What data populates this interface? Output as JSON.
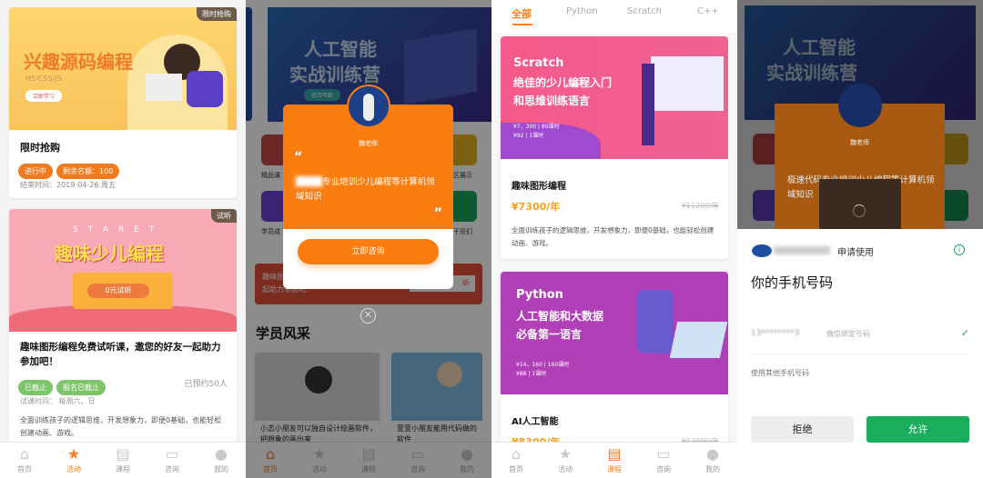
{
  "colors": {
    "accent": "#f57d22",
    "green": "#7ec46a",
    "wechat_green": "#1aad5b"
  },
  "nav": [
    "首页",
    "活动",
    "课程",
    "咨询",
    "我的"
  ],
  "panel1": {
    "card1": {
      "tag": "限时抢购",
      "banner_title": "兴趣源码编程",
      "banner_sub": "H5/CSS/JS",
      "banner_button": "立即学习",
      "title": "限时抢购",
      "badges": [
        "进行中",
        "剩余名额：100"
      ],
      "end_time": "结束时间：2019-04-26 周五"
    },
    "card2": {
      "tag": "试听",
      "banner_letters": "S T A R E T",
      "banner_title": "趣味少儿编程",
      "banner_button": "0元试听",
      "title": "趣味图形编程免费试听课，邀您的好友一起助力参加吧！",
      "badges": [
        "已截止",
        "报名已截止"
      ],
      "booked": "已预约50人",
      "trial_time": "试课时间： 每周六、日",
      "desc": "全面训练孩子的逻辑思维，开发想象力，即便0基础，也能轻松创建动画、游戏。"
    }
  },
  "panel2": {
    "banner_title1": "人工智能",
    "banner_title2": "实战训练营",
    "banner_chip": "适合年龄",
    "grid_labels": [
      "精品课",
      "区展示",
      "学员成",
      "干货们"
    ],
    "popup": {
      "teacher": "魏老师",
      "quote": "专业培训少儿编程等计算机领域知识",
      "button": "立即咨询"
    },
    "promo": "趣味图形编程免费试听课，邀您的好友一起助力参加吧！",
    "promo_btn": "听",
    "section_title": "学员风采",
    "stories": [
      "小志小朋友可以独自设计绘画软件，把想象的画出来",
      "萱萱小朋友能用代码做的软件"
    ]
  },
  "panel3": {
    "tabs": [
      "全部",
      "Python",
      "Scratch",
      "C++"
    ],
    "courses": [
      {
        "banner_lang": "Scratch",
        "banner_l1": "绝佳的少儿编程入门",
        "banner_l2": "和思维训练语言",
        "banner_price1": "¥7，300 | 80课时",
        "banner_price2": "¥92 | 1课时",
        "title": "趣味图形编程",
        "price": "¥7300/年",
        "old_price": "¥11200/年",
        "desc": "全面训练孩子的逻辑思维，开发想象力，即便0基础，也能轻松创建动画、游戏。"
      },
      {
        "banner_lang": "Python",
        "banner_l1": "人工智能和大数据",
        "banner_l2": "必备第一语言",
        "banner_price1": "¥14，160 | 160课时",
        "banner_price2": "¥88 | 1课时",
        "title": "AI人工智能",
        "price": "¥8300/年",
        "old_price": "¥12000/年"
      }
    ]
  },
  "panel4": {
    "teacher": "魏老师",
    "quote": "极速代码专业培训少儿编程等计算机领域知识",
    "sheet": {
      "request": "申请使用",
      "title": "你的手机号码",
      "phone": "13********3",
      "phone_note": "微信绑定号码",
      "other": "使用其他手机号码",
      "reject": "拒绝",
      "allow": "允许"
    }
  }
}
